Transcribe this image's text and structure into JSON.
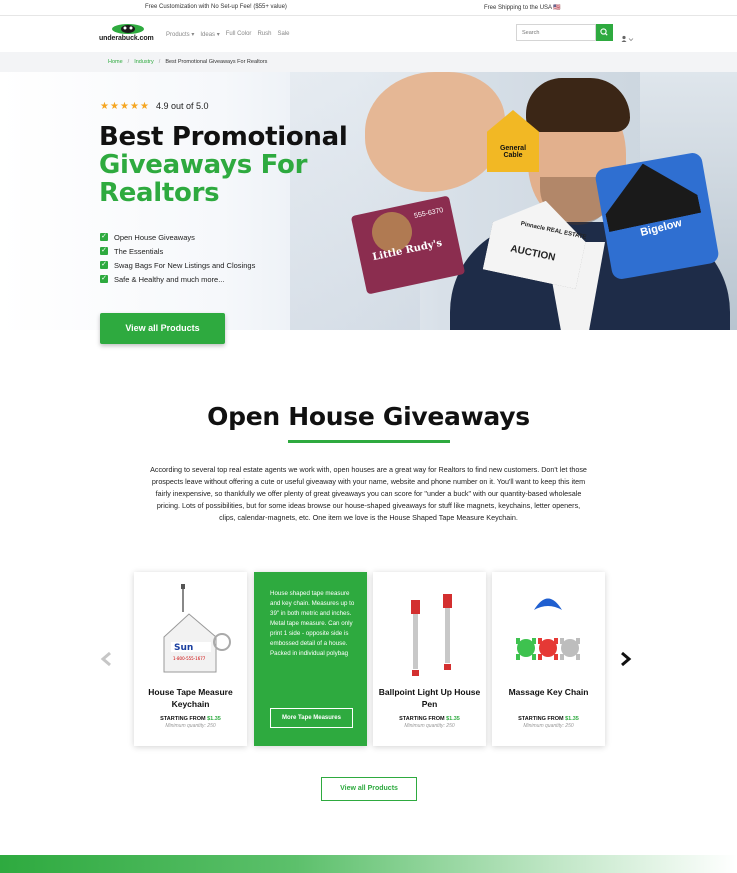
{
  "topbar": {
    "left": "Free Customization with No Set-up Fee! ($55+ value)",
    "right": "Free Shipping to the USA 🇺🇸"
  },
  "header": {
    "logo_text": "underabuck.com",
    "nav": [
      "Products",
      "Ideas",
      "Full Color",
      "Rush",
      "Sale"
    ],
    "search_placeholder": "Search"
  },
  "breadcrumb": [
    "Home",
    "Industry",
    "Best Promotional Giveaways For Realtors"
  ],
  "hero": {
    "rating": 4.9,
    "rating_text": "4.9 out of 5.0",
    "title_line1": "Best Promotional",
    "title_line2": "Giveaways For",
    "title_line3": "Realtors",
    "checks": [
      "Open House Giveaways",
      "The Essentials",
      "Swag Bags For New Listings and Closings",
      "Safe & Healthy and much more..."
    ],
    "button": "View all Products",
    "product_labels": {
      "general_cable": "General Cable",
      "bigelow": "Bigelow",
      "auction": "AUCTION",
      "pinnacle": "Pinnacle REAL ESTATE",
      "dog_name": "Little Rudy's",
      "dog_phone": "555-6370"
    }
  },
  "section": {
    "title": "Open House Giveaways",
    "paragraph": "According to several top real estate agents we work with, open houses are a great way for Realtors to find new customers.  Don't let those prospects leave without offering a cute or useful giveaway with your name, website and phone number on it.  You'll want to keep this item fairly inexpensive, so thankfully we offer plenty of great giveaways you can score for \"under a buck\" with our quantity-based wholesale pricing. Lots of possibilities, but for some ideas browse our house-shaped giveaways for stuff like magnets, keychains, letter openers, clips, calendar-magnets, etc.  One item we love is the House Shaped Tape Measure Keychain."
  },
  "products": [
    {
      "name": "House Tape Measure Keychain",
      "price_label": "STARTING FROM",
      "price": "$1.35",
      "min": "Minimum quantity: 250",
      "icon": "tape-measure-keychain"
    },
    {
      "description": "House shaped tape measure and key chain. Measures up to 39\" in both metric and inches. Metal tape measure. Can only print 1 side - opposite side is embossed detail of a house. Packed in individual polybag",
      "button": "More Tape Measures"
    },
    {
      "name": "Ballpoint Light Up House Pen",
      "price_label": "STARTING FROM",
      "price": "$1.35",
      "min": "Minimum quantity: 250",
      "icon": "light-up-pen"
    },
    {
      "name": "Massage Key Chain",
      "price_label": "STARTING FROM",
      "price": "$1.35",
      "min": "Minimum quantity: 250",
      "icon": "massage-keychain"
    }
  ],
  "view_all": "View all Products",
  "colors": {
    "accent": "#2eaa3f",
    "star": "#f5a623"
  }
}
